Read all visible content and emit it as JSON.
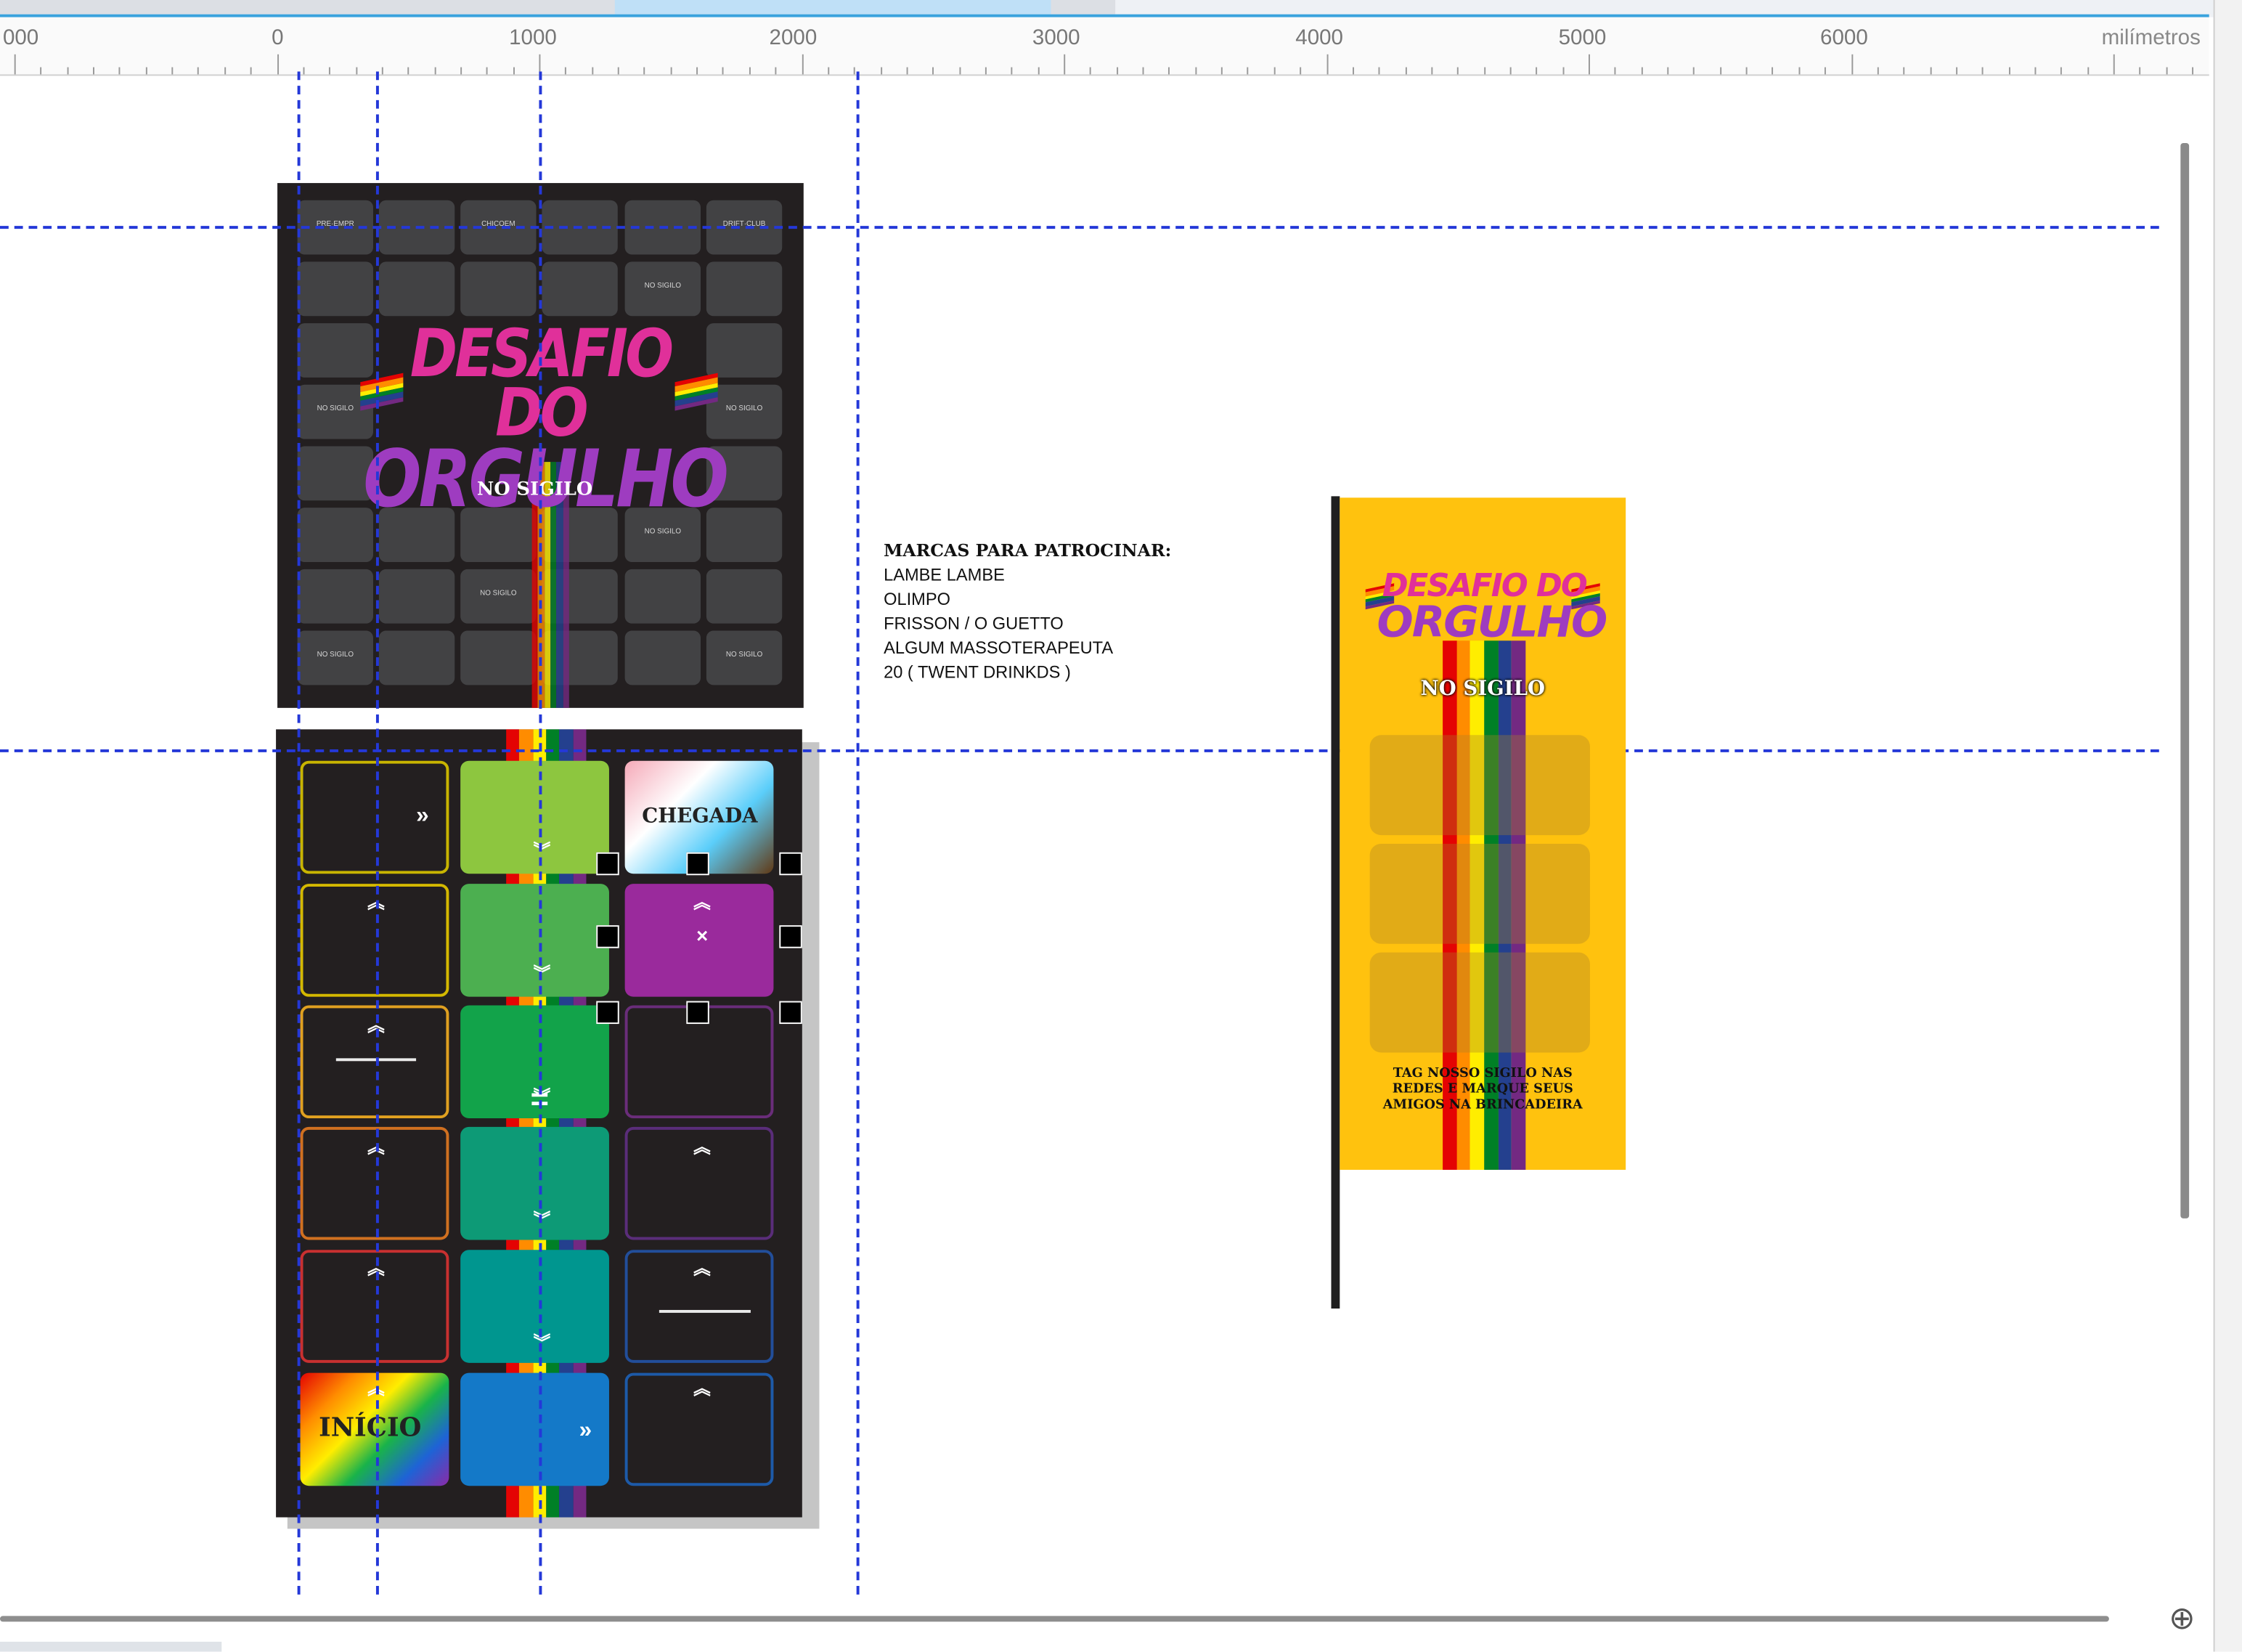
{
  "ruler": {
    "labels": [
      "000",
      "0",
      "1000",
      "2000",
      "3000",
      "4000",
      "5000",
      "6000"
    ],
    "unit": "milímetros"
  },
  "board_top": {
    "cell_labels": [
      "PRE·EMPR",
      "CHICOEM",
      "DRIFT·CLUB",
      "NO SIGILO",
      "NO SIGILO",
      "NO SIGILO",
      "NO SIGILO",
      "NO SIGILO",
      "NO SIGILO",
      "NO SIGILO"
    ],
    "logo_line1": "DESAFIO DO",
    "logo_line2": "ORGULHO",
    "logo_sub": "NO SIGILO"
  },
  "board_bottom": {
    "finish_label": "CHEGADA",
    "start_label": "INÍCIO",
    "arrow_up": "︽",
    "arrow_down": "︾",
    "arrow_right": "»",
    "equals": "=",
    "times": "×"
  },
  "notes": {
    "title": "MARCAS PARA PATROCINAR:",
    "lines": [
      "LAMBE LAMBE",
      "OLIMPO",
      "FRISSON / O GUETTO",
      "ALGUM MASSOTERAPEUTA",
      "20 ( TWENT DRINKDS )"
    ]
  },
  "banner": {
    "title_line1": "DESAFIO DO",
    "title_line2": "ORGULHO",
    "subtitle": "NO SIGILO",
    "footer": "TAG NOSSO SIGILO NAS REDES E MARQUE SEUS AMIGOS NA BRINCADEIRA"
  },
  "colors": {
    "guide": "#2438d8",
    "board_bg": "#231f20",
    "banner_bg": "#ffc20e",
    "logo_pink": "#e0309a",
    "logo_purple": "#9e3cc0",
    "rainbow": [
      "#e40303",
      "#ff8c00",
      "#ffed00",
      "#008026",
      "#24408e",
      "#732982"
    ]
  },
  "icons": [
    "zoom-icon"
  ]
}
